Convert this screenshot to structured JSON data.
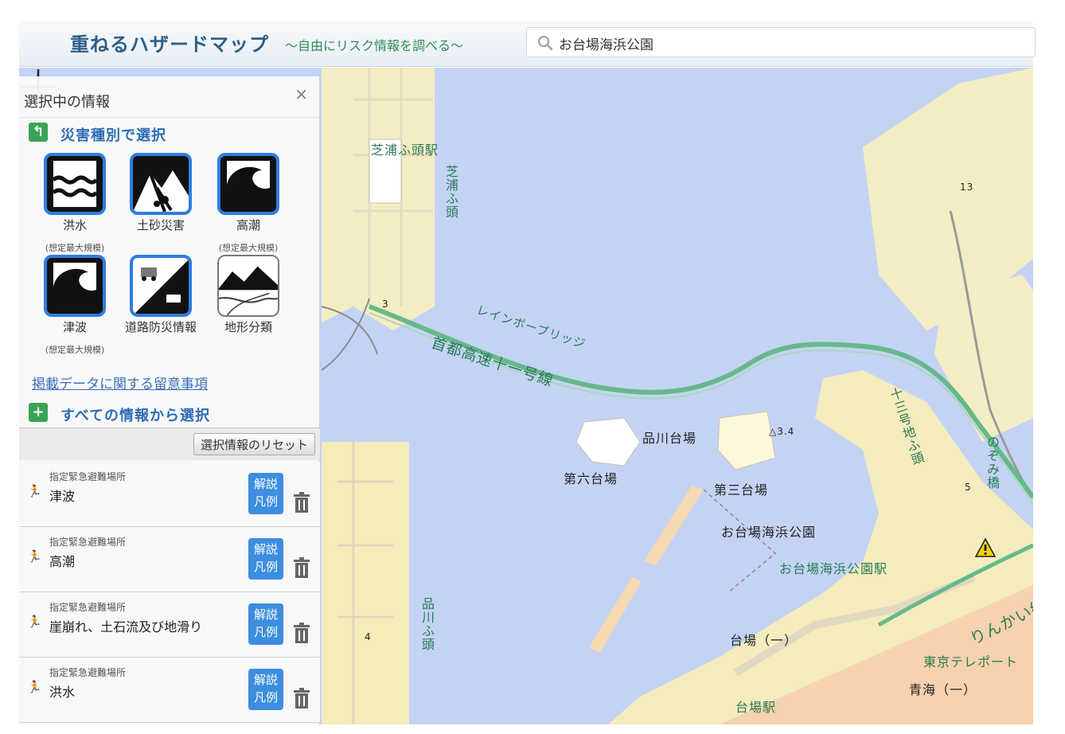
{
  "header": {
    "title": "重ねるハザードマップ",
    "subtitle": "〜自由にリスク情報を調べる〜",
    "search_value": "お台場海浜公園"
  },
  "panel": {
    "title": "選択中の情報",
    "close": "×",
    "by_disaster_label": "災害種別で選択",
    "by_disaster_icon": "↰",
    "hazards": [
      {
        "label": "洪水",
        "sub": "(想定最大規模)",
        "icon": "flood-icon",
        "selected": true
      },
      {
        "label": "土砂災害",
        "sub": "",
        "icon": "landslide-icon",
        "selected": true
      },
      {
        "label": "高潮",
        "sub": "(想定最大規模)",
        "icon": "storm-surge-icon",
        "selected": true
      },
      {
        "label": "津波",
        "sub": "(想定最大規模)",
        "icon": "tsunami-icon",
        "selected": true
      },
      {
        "label": "道路防災情報",
        "sub": "",
        "icon": "road-disaster-icon",
        "selected": true
      },
      {
        "label": "地形分類",
        "sub": "",
        "icon": "terrain-icon",
        "selected": false
      }
    ],
    "notice_link": "掲載データに関する留意事項",
    "all_info_label": "すべての情報から選択",
    "all_info_icon": "+",
    "reset_label": "選択情報のリセット",
    "layers": [
      {
        "category": "指定緊急避難場所",
        "name": "津波",
        "legend": [
          "解説",
          "凡例"
        ]
      },
      {
        "category": "指定緊急避難場所",
        "name": "高潮",
        "legend": [
          "解説",
          "凡例"
        ]
      },
      {
        "category": "指定緊急避難場所",
        "name": "崖崩れ、土石流及び地滑り",
        "legend": [
          "解説",
          "凡例"
        ]
      },
      {
        "category": "指定緊急避難場所",
        "name": "洪水",
        "legend": [
          "解説",
          "凡例"
        ]
      }
    ]
  },
  "map": {
    "labels": {
      "shibaura_station": "芝浦ふ頭駅",
      "shibaura_pier": "芝浦ふ頭",
      "rainbow_bridge": "レインボーブリッジ",
      "expressway": "首都高速十一号線",
      "shinagawa_daiba": "品川台場",
      "dai6_daiba": "第六台場",
      "dai3_daiba": "第三台場",
      "odaiba_park": "お台場海浜公園",
      "odaiba_park_station": "お台場海浜公園駅",
      "jusangochi": "十三号地ふ頭",
      "nozomi_bridge": "のぞみ橋",
      "shinagawa_pier": "品川ふ頭",
      "daiba_1": "台場（一）",
      "rinkai_line": "りんかい線",
      "tokyo_teleport": "東京テレポート",
      "aomi_1": "青海（一）",
      "daiba_station": "台場駅",
      "elevation": "△3.4",
      "road_13": "13",
      "num_3": "3",
      "num_4": "4",
      "num_5": "5"
    }
  },
  "colors": {
    "water": "#c4d3f4",
    "land": "#f2efe1",
    "hazard_yellow": "#f6eaa0",
    "hazard_orange": "#f6c8a8",
    "road_green": "#66b98a",
    "accent_blue": "#2f7de1"
  }
}
